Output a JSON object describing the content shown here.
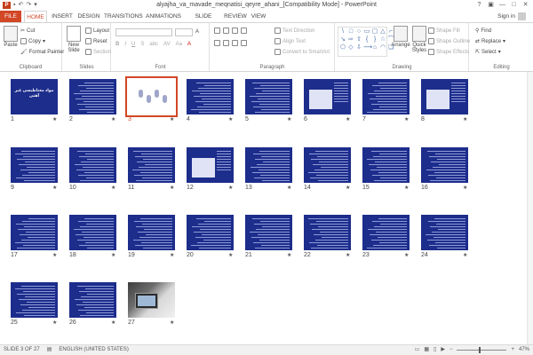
{
  "title_bar": {
    "app_icon": "P",
    "quick_access": [
      "save-icon",
      "undo-icon",
      "redo-icon",
      "customize-icon"
    ],
    "document_title": "alyajha_va_mavade_meqnatisi_qeyre_ahani_[Compatibility Mode] - PowerPoint",
    "help": "?",
    "ribbon_options": "▣",
    "minimize": "—",
    "maximize": "□",
    "close": "✕"
  },
  "tabs": {
    "file": "FILE",
    "items": [
      {
        "label": "HOME",
        "active": true
      },
      {
        "label": "INSERT",
        "active": false
      },
      {
        "label": "DESIGN",
        "active": false
      },
      {
        "label": "TRANSITIONS",
        "active": false
      },
      {
        "label": "ANIMATIONS",
        "active": false
      },
      {
        "label": "SLIDE SHOW",
        "active": false
      },
      {
        "label": "REVIEW",
        "active": false
      },
      {
        "label": "VIEW",
        "active": false
      }
    ],
    "sign_in": "Sign in"
  },
  "ribbon": {
    "clipboard": {
      "label": "Clipboard",
      "paste": "Paste",
      "cut": "Cut",
      "copy": "Copy",
      "format_painter": "Format Painter"
    },
    "slides": {
      "label": "Slides",
      "new_slide": "New Slide",
      "layout": "Layout",
      "reset": "Reset",
      "section": "Section"
    },
    "font": {
      "label": "Font",
      "buttons": [
        "B",
        "I",
        "U",
        "S",
        "abc",
        "AV",
        "Aa",
        "A"
      ]
    },
    "paragraph": {
      "label": "Paragraph",
      "text_direction": "Text Direction",
      "align_text": "Align Text",
      "convert_smartart": "Convert to SmartArt"
    },
    "drawing": {
      "label": "Drawing",
      "shapes": [
        "\\",
        "□",
        "○",
        "▭",
        "▢",
        "△",
        "⌐",
        "↘",
        "⇨",
        "⇧",
        "{",
        "}",
        "☆",
        "⌒",
        "⬠",
        "◇",
        "⇩",
        "⟶",
        "⌂",
        "◠",
        "❏"
      ],
      "arrange": "Arrange",
      "quick_styles": "Quick Styles",
      "shape_fill": "Shape Fill",
      "shape_outline": "Shape Outline",
      "shape_effects": "Shape Effects"
    },
    "editing": {
      "label": "Editing",
      "find": "Find",
      "replace": "Replace",
      "select": "Select"
    }
  },
  "slides": {
    "selected": 3,
    "title_slide_text": "مواد مغناطیسی غیر آهنی",
    "items": [
      {
        "num": "1",
        "kind": "title"
      },
      {
        "num": "2",
        "kind": "text"
      },
      {
        "num": "3",
        "kind": "chart"
      },
      {
        "num": "4",
        "kind": "text"
      },
      {
        "num": "5",
        "kind": "text"
      },
      {
        "num": "6",
        "kind": "table"
      },
      {
        "num": "7",
        "kind": "text"
      },
      {
        "num": "8",
        "kind": "table"
      },
      {
        "num": "9",
        "kind": "text"
      },
      {
        "num": "10",
        "kind": "text"
      },
      {
        "num": "11",
        "kind": "text"
      },
      {
        "num": "12",
        "kind": "table"
      },
      {
        "num": "13",
        "kind": "text"
      },
      {
        "num": "14",
        "kind": "text"
      },
      {
        "num": "15",
        "kind": "text"
      },
      {
        "num": "16",
        "kind": "text"
      },
      {
        "num": "17",
        "kind": "text"
      },
      {
        "num": "18",
        "kind": "text"
      },
      {
        "num": "19",
        "kind": "text"
      },
      {
        "num": "20",
        "kind": "text"
      },
      {
        "num": "21",
        "kind": "text"
      },
      {
        "num": "22",
        "kind": "text"
      },
      {
        "num": "23",
        "kind": "text"
      },
      {
        "num": "24",
        "kind": "text"
      },
      {
        "num": "25",
        "kind": "text"
      },
      {
        "num": "26",
        "kind": "text"
      },
      {
        "num": "27",
        "kind": "photo"
      }
    ],
    "star": "★"
  },
  "status_bar": {
    "slide_indicator": "SLIDE 3 OF 27",
    "language": "ENGLISH (UNITED STATES)",
    "zoom_level": "47%",
    "zoom_minus": "−",
    "zoom_plus": "+"
  },
  "colors": {
    "accent": "#d24726",
    "slide_background": "#1d2d8c"
  }
}
